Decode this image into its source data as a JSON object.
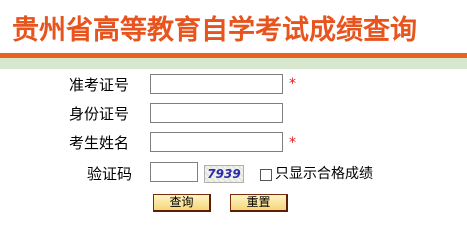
{
  "page": {
    "title": "贵州省高等教育自学考试成绩查询"
  },
  "form": {
    "exam_id_label": "准考证号",
    "exam_id_value": "",
    "id_card_label": "身份证号",
    "id_card_value": "",
    "name_label": "考生姓名",
    "name_value": "",
    "captcha_label": "验证码",
    "captcha_value": "",
    "captcha_text": "7939",
    "required_mark": "*",
    "only_pass_label": "只显示合格成绩",
    "only_pass_checked": false
  },
  "buttons": {
    "query": "查询",
    "reset": "重置"
  },
  "colors": {
    "title": "#e8541e",
    "header_rule": "#e8651f",
    "header_band": "#d8e8cf",
    "required": "#e0191f"
  }
}
